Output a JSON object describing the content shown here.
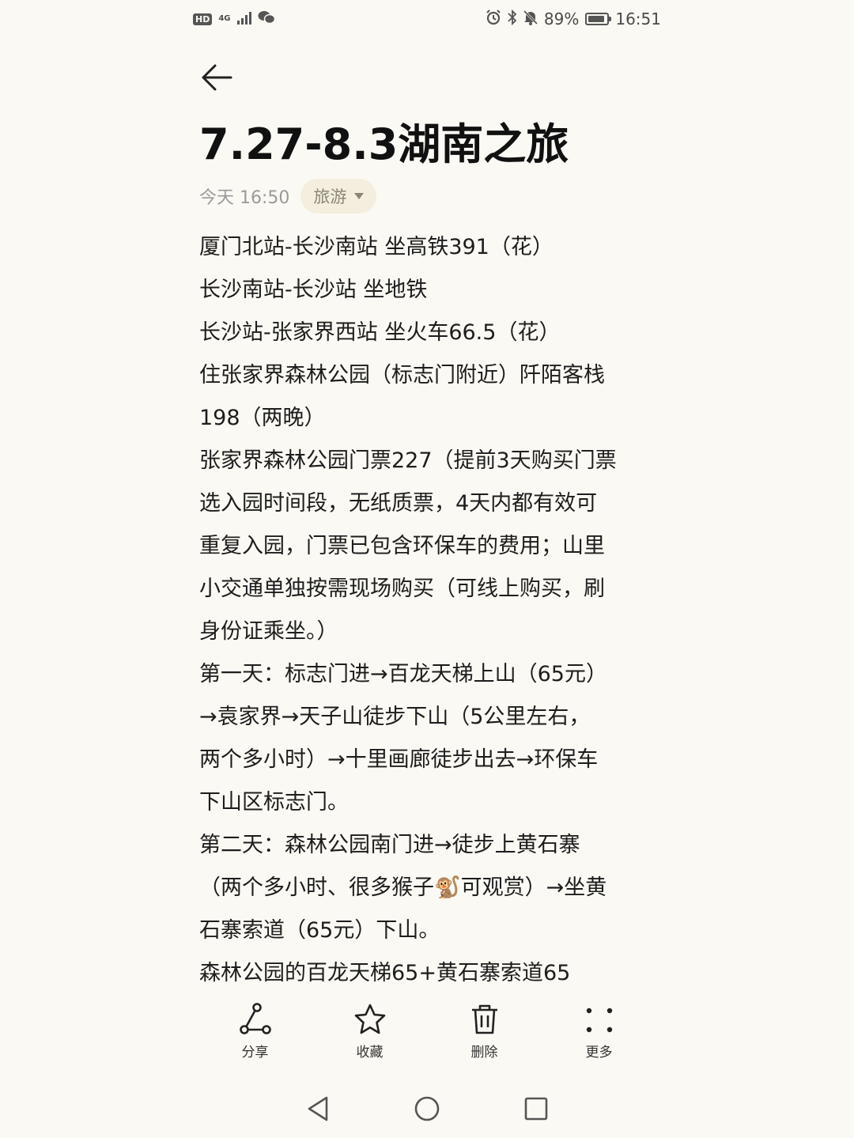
{
  "status_bar": {
    "hd": "HD",
    "network": "4G",
    "battery_percent": "89%",
    "battery_level": 0.89,
    "time": "16:51"
  },
  "note": {
    "title": "7.27-8.3湖南之旅",
    "date": "今天 16:50",
    "category": "旅游",
    "lines": [
      "厦门北站-长沙南站 坐高铁391（花）",
      "长沙南站-长沙站 坐地铁",
      "长沙站-张家界西站 坐火车66.5（花）",
      "住张家界森林公园（标志门附近）阡陌客栈",
      "198（两晚）",
      "张家界森林公园门票227（提前3天购买门票",
      "选入园时间段，无纸质票，4天内都有效可",
      "重复入园，门票已包含环保车的费用；山里",
      "小交通单独按需现场购买（可线上购买，刷",
      "身份证乘坐。）",
      "第一天：标志门进→百龙天梯上山（65元）",
      "→袁家界→天子山徒步下山（5公里左右，",
      "两个多小时）→十里画廊徒步出去→环保车",
      "下山区标志门。",
      "第二天：森林公园南门进→徒步上黄石寨",
      "（两个多小时、很多猴子🐒可观赏）→坐黄",
      "石寨索道（65元）下山。",
      "森林公园的百龙天梯65+黄石寨索道65"
    ]
  },
  "toolbar": {
    "share_label": "分享",
    "favorite_label": "收藏",
    "delete_label": "删除",
    "more_label": "更多"
  },
  "icons": {
    "back": "back-arrow-icon",
    "share": "share-icon",
    "favorite": "star-icon",
    "delete": "trash-icon",
    "more": "more-dots-icon",
    "nav_back": "nav-back-triangle-icon",
    "nav_home": "nav-home-circle-icon",
    "nav_recent": "nav-recent-square-icon"
  }
}
